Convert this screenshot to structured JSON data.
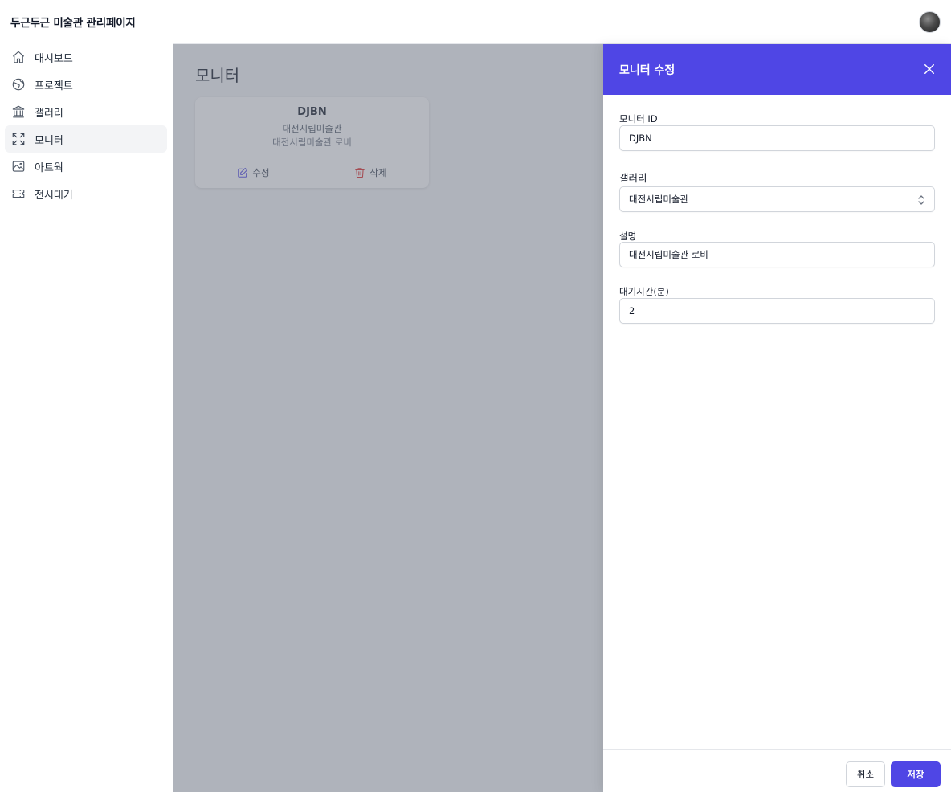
{
  "app": {
    "title": "두근두근 미술관 관리페이지"
  },
  "sidebar": {
    "items": [
      {
        "label": "대시보드",
        "icon": "home-icon"
      },
      {
        "label": "프로젝트",
        "icon": "globe-icon"
      },
      {
        "label": "갤러리",
        "icon": "building-icon"
      },
      {
        "label": "모니터",
        "icon": "expand-icon",
        "active": true
      },
      {
        "label": "아트웍",
        "icon": "image-icon"
      },
      {
        "label": "전시대기",
        "icon": "ticket-icon"
      }
    ]
  },
  "main": {
    "page_title": "모니터",
    "card": {
      "id": "DJBN",
      "gallery": "대전시립미술관",
      "description": "대전시립미술관 로비",
      "edit_label": "수정",
      "delete_label": "삭제"
    }
  },
  "drawer": {
    "title": "모니터 수정",
    "fields": {
      "monitor_id": {
        "label": "모니터 ID",
        "value": "DJBN"
      },
      "gallery": {
        "label": "갤러리",
        "value": "대전시립미술관"
      },
      "description": {
        "label": "설명",
        "value": "대전시립미술관 로비"
      },
      "wait_time": {
        "label": "대기시간(분)",
        "value": "2"
      }
    },
    "cancel_label": "취소",
    "save_label": "저장"
  },
  "colors": {
    "accent": "#4f46e5",
    "delete": "#dc2626",
    "overlay": "#6b7280"
  }
}
